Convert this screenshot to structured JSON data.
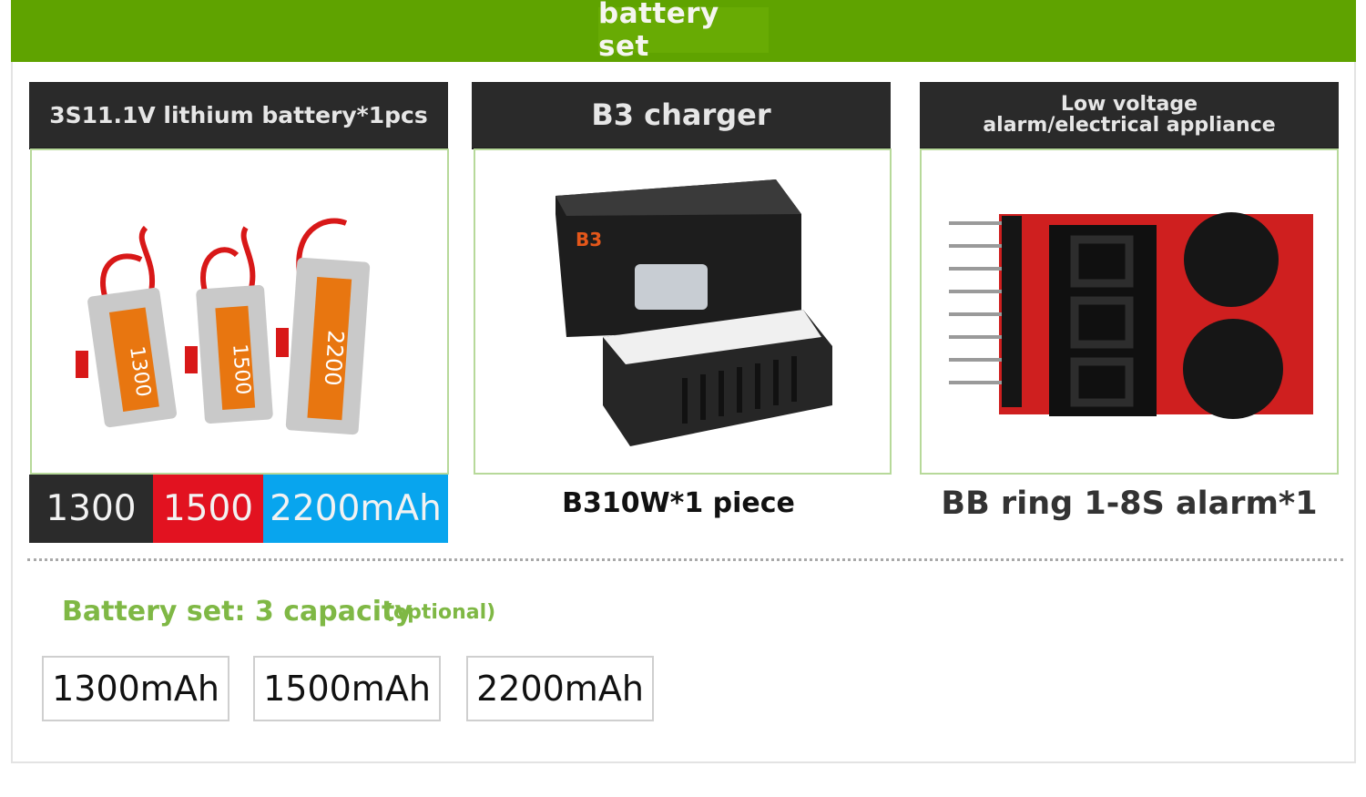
{
  "header": {
    "title": "battery set"
  },
  "products": [
    {
      "title": "3S11.1V lithium battery*1pcs",
      "image_icon": "lipo-battery-pack-icon"
    },
    {
      "title": "B3 charger",
      "image_icon": "charger-icon",
      "caption": "B310W*1 piece"
    },
    {
      "title": "Low voltage alarm/electrical appliance",
      "image_icon": "voltage-alarm-icon",
      "caption": "BB ring 1-8S alarm*1"
    }
  ],
  "battery_labels": {
    "capacities": [
      "1300",
      "1500",
      "2200mAh"
    ],
    "colors": [
      "#2b2b2b",
      "#e21220",
      "#08a5ee"
    ]
  },
  "options": {
    "title": "Battery set: 3 capacity",
    "note": "(optional)",
    "items": [
      "1300mAh",
      "1500mAh",
      "2200mAh"
    ]
  },
  "colors": {
    "brand_green": "#5fa300",
    "accent_green": "#7fb845",
    "header_dark": "#2a2a2a"
  }
}
